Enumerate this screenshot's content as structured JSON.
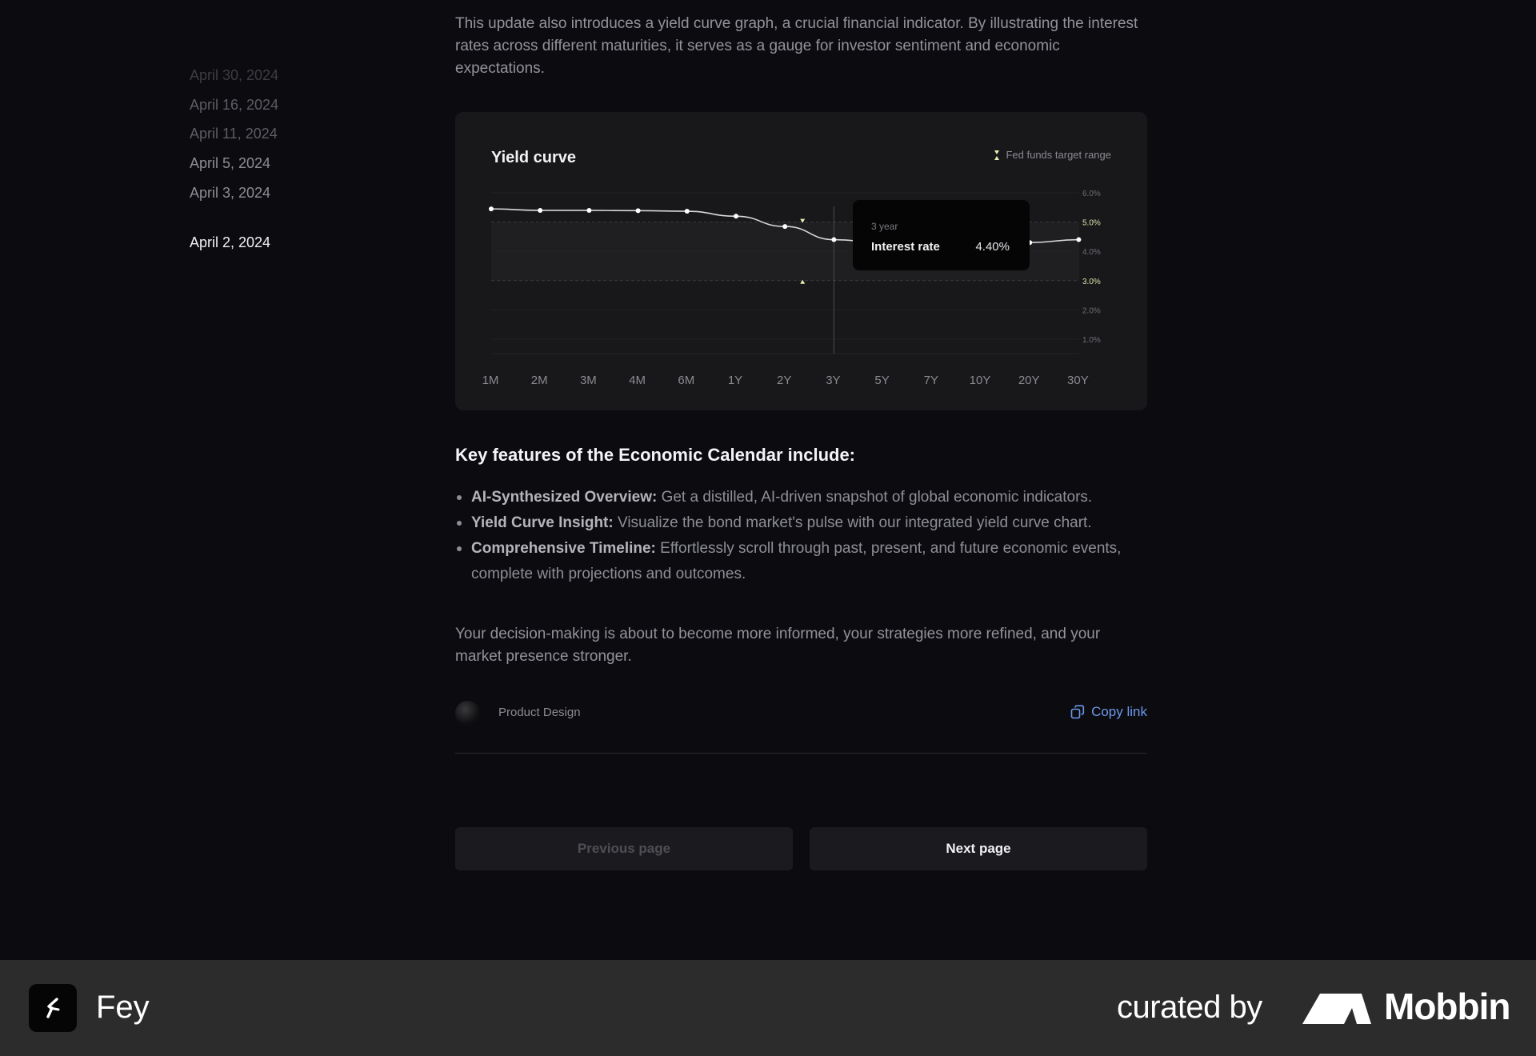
{
  "sidebar": {
    "dates": [
      {
        "label": "April 30, 2024",
        "state": "faded"
      },
      {
        "label": "April 16, 2024",
        "state": "dim"
      },
      {
        "label": "April 11, 2024",
        "state": "dim"
      },
      {
        "label": "April 5, 2024",
        "state": "normal"
      },
      {
        "label": "April 3, 2024",
        "state": "normal"
      }
    ],
    "active_date": "April 2, 2024"
  },
  "article": {
    "intro": "This update also introduces a yield curve graph, a crucial financial indicator. By illustrating the interest rates across different maturities, it serves as a gauge for investor sentiment and economic expectations.",
    "heading": "Key features of the Economic Calendar include:",
    "features": [
      {
        "title": "AI-Synthesized Overview:",
        "text": " Get a distilled, AI-driven snapshot of global economic indicators."
      },
      {
        "title": "Yield Curve Insight:",
        "text": " Visualize the bond market's pulse with our integrated yield curve chart."
      },
      {
        "title": "Comprehensive Timeline:",
        "text": " Effortlessly scroll through past, present, and future economic events, complete with projections and outcomes."
      }
    ],
    "closing": "Your decision-making is about to become more informed, your strategies more refined, and your market presence stronger.",
    "category": "Product Design",
    "copy_link": "Copy link"
  },
  "chart": {
    "title": "Yield curve",
    "legend": "Fed funds target range",
    "tooltip": {
      "label": "3 year",
      "name": "Interest rate",
      "value": "4.40%"
    }
  },
  "chart_data": {
    "type": "line",
    "title": "Yield curve",
    "categories": [
      "1M",
      "2M",
      "3M",
      "4M",
      "6M",
      "1Y",
      "2Y",
      "3Y",
      "5Y",
      "7Y",
      "10Y",
      "20Y",
      "30Y"
    ],
    "series": [
      {
        "name": "Interest rate",
        "values": [
          5.45,
          5.4,
          5.4,
          5.39,
          5.37,
          5.2,
          4.85,
          4.4,
          4.3,
          4.3,
          4.3,
          4.3,
          4.4
        ]
      }
    ],
    "y_ticks": [
      "6.0%",
      "5.0%",
      "4.0%",
      "3.0%",
      "2.0%",
      "1.0%"
    ],
    "ylim": [
      1.0,
      6.0
    ],
    "target_range": [
      3.0,
      5.0
    ],
    "grid": true,
    "legend_position": "top-right"
  },
  "pagination": {
    "previous": "Previous page",
    "next": "Next page"
  },
  "footer": {
    "app_name": "Fey",
    "curated_by": "curated by",
    "brand": "Mobbin"
  },
  "colors": {
    "background": "#0c0c10",
    "card": "#18181b",
    "accent_link": "#6d97ea",
    "range_marker": "#e7efb0"
  }
}
